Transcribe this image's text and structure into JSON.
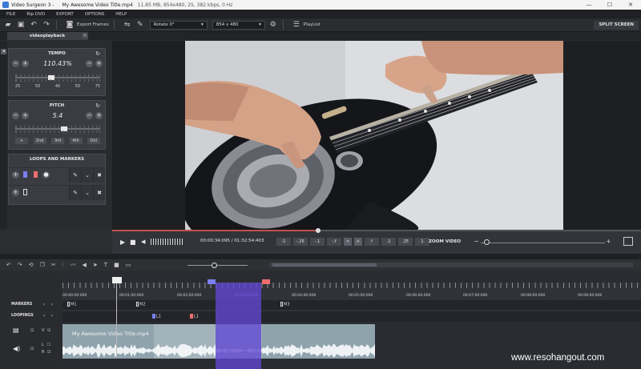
{
  "titlebar": {
    "app": "Video Surgeon 3 -",
    "file": "My Awesome Video Title.mp4",
    "info": "11.85 MB, 854x480, 25, 382 kbps, 0 Hz",
    "min": "—",
    "max": "☐",
    "close": "✕"
  },
  "menu": [
    "FILE",
    "Rip DVD",
    "EXPORT",
    "OPTIONS",
    "HELP"
  ],
  "toolbar": {
    "export_frames": "Export Frames",
    "rotate": "Rotate 0°",
    "resolution": "854 x 480",
    "playlist": "PlayList",
    "split_screen": "SPLIT SCREEN"
  },
  "tab": {
    "label": "videoplayback",
    "close": "×"
  },
  "tempo": {
    "title": "TEMPO",
    "value": "110.43%",
    "value_fraction": 0.42,
    "scale": [
      "25",
      "50",
      "40",
      "50",
      "75"
    ]
  },
  "pitch": {
    "title": "PITCH",
    "value": "5.4",
    "value_fraction": 0.58,
    "buttons": [
      "+",
      "2nd",
      "3rd",
      "4th",
      "Oct"
    ]
  },
  "loops": {
    "title": "LOOPS AND MARKERS"
  },
  "transport": {
    "timecode": "00:00:34:095 / 01:32:54:403",
    "progress": 0.39,
    "steps": [
      "-1",
      "-.25",
      "-.1",
      "-.f",
      "<",
      ">",
      "f",
      ".1",
      ".25",
      "1"
    ],
    "zoom_label": "ZOOM VIDEO",
    "zoom_minus": "−",
    "zoom_plus": "+",
    "zoom_fraction": 0.05
  },
  "timeline": {
    "timecodes": [
      "00:00:00:000",
      "00:01:00:000",
      "00:02:00:000",
      "00:03:00:000",
      "00:04:00:000",
      "00:05:00:000",
      "00:06:00:000",
      "00:07:00:000",
      "00:08:00:000",
      "00:09:00:000"
    ],
    "markers_label": "MARKERS",
    "loopings_label": "LOOPINGS",
    "markers": [
      "M1",
      "M2",
      "M3"
    ],
    "loops": [
      "L1",
      "L1"
    ],
    "clip_title": "My Awesome Video Title.mp4",
    "v_label": "V",
    "l_label": "L",
    "r_label": "R"
  },
  "colors": {
    "loop_left": "#7a7ff0",
    "loop_right": "#ef6e6e",
    "loop_region": "#6046d2",
    "progress": "#c0504d"
  },
  "watermark": "www.resohangout.com"
}
